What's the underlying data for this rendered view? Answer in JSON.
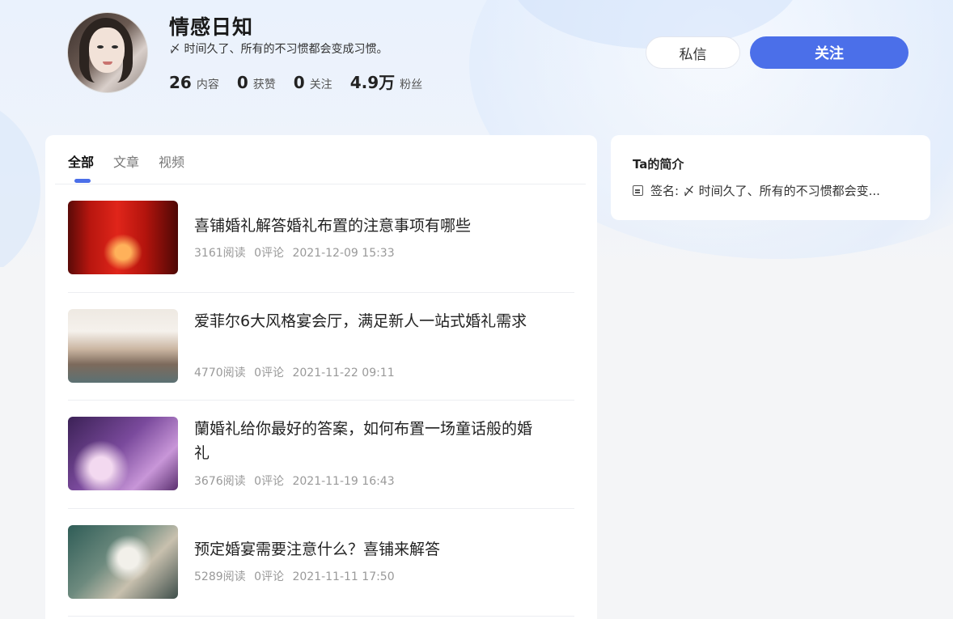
{
  "profile": {
    "name": "情感日知",
    "signature": "〆 时间久了、所有的不习惯都会变成习惯。",
    "stats": [
      {
        "num": "26",
        "label": "内容"
      },
      {
        "num": "0",
        "label": "获赞"
      },
      {
        "num": "0",
        "label": "关注"
      },
      {
        "num": "4.9万",
        "label": "粉丝"
      }
    ]
  },
  "actions": {
    "message_label": "私信",
    "follow_label": "关注"
  },
  "tabs": [
    {
      "label": "全部",
      "active": true
    },
    {
      "label": "文章",
      "active": false
    },
    {
      "label": "视频",
      "active": false
    }
  ],
  "articles": [
    {
      "title": "喜铺婚礼解答婚礼布置的注意事项有哪些",
      "reads": "3161阅读",
      "comments": "0评论",
      "date": "2021-12-09 15:33"
    },
    {
      "title": "爱菲尔6大风格宴会厅，满足新人一站式婚礼需求",
      "reads": "4770阅读",
      "comments": "0评论",
      "date": "2021-11-22 09:11"
    },
    {
      "title": "蘭婚礼给你最好的答案，如何布置一场童话般的婚礼",
      "reads": "3676阅读",
      "comments": "0评论",
      "date": "2021-11-19 16:43"
    },
    {
      "title": "预定婚宴需要注意什么？喜铺来解答",
      "reads": "5289阅读",
      "comments": "0评论",
      "date": "2021-11-11 17:50"
    }
  ],
  "sidebar": {
    "title": "Ta的简介",
    "sign_text": "签名: 〆 时间久了、所有的不习惯都会变..."
  },
  "colors": {
    "accent": "#4b6fe9",
    "page_bg": "#f4f5f7"
  }
}
